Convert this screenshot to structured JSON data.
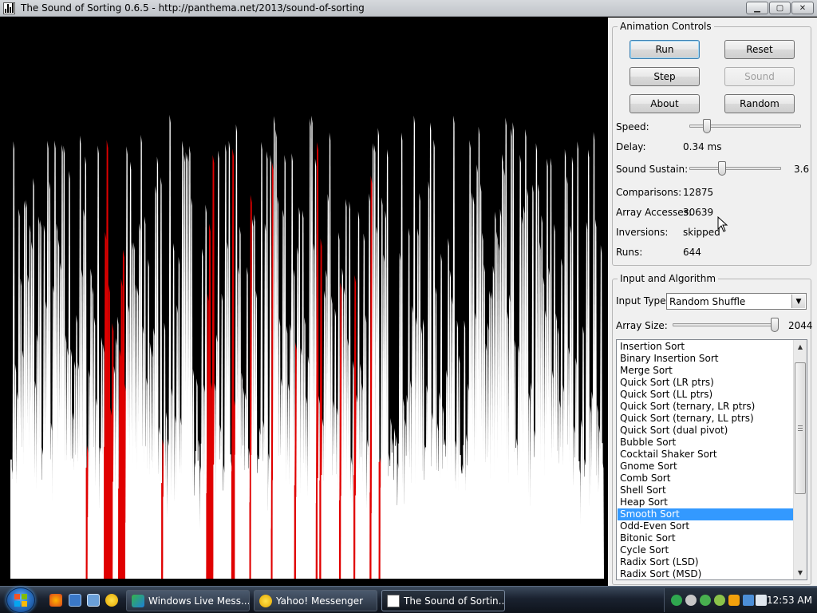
{
  "window": {
    "title": "The Sound of Sorting 0.6.5 - http://panthema.net/2013/sound-of-sorting",
    "minimize_label": "▁",
    "maximize_label": "▢",
    "close_label": "✕"
  },
  "animation_controls": {
    "legend": "Animation Controls",
    "buttons": {
      "run": "Run",
      "reset": "Reset",
      "step": "Step",
      "sound": "Sound",
      "about": "About",
      "random": "Random"
    },
    "speed_label": "Speed:",
    "speed_level": 0.16,
    "delay_label": "Delay:",
    "delay_value": "0.34 ms",
    "sustain_label": "Sound Sustain:",
    "sustain_level": 0.36,
    "sustain_value": "3.6",
    "comparisons_label": "Comparisons:",
    "comparisons_value": "12875",
    "accesses_label": "Array Accesses:",
    "accesses_value": "30639",
    "inversions_label": "Inversions:",
    "inversions_value": "skipped",
    "runs_label": "Runs:",
    "runs_value": "644"
  },
  "input_algorithm": {
    "legend": "Input and Algorithm",
    "input_type_label": "Input Type:",
    "input_type_value": "Random Shuffle",
    "array_size_label": "Array Size:",
    "array_size_level": 0.96,
    "array_size_value": "2044",
    "algorithms": [
      "Insertion Sort",
      "Binary Insertion Sort",
      "Merge Sort",
      "Quick Sort (LR ptrs)",
      "Quick Sort (LL ptrs)",
      "Quick Sort (ternary, LR ptrs)",
      "Quick Sort (ternary, LL ptrs)",
      "Quick Sort (dual pivot)",
      "Bubble Sort",
      "Cocktail Shaker Sort",
      "Gnome Sort",
      "Comb Sort",
      "Shell Sort",
      "Heap Sort",
      "Smooth Sort",
      "Odd-Even Sort",
      "Bitonic Sort",
      "Cycle Sort",
      "Radix Sort (LSD)",
      "Radix Sort (MSD)"
    ],
    "selected_index": 14
  },
  "colors": {
    "bar": "#ffffff",
    "highlight": "#e00000",
    "background": "#000000",
    "selection": "#3399ff"
  },
  "taskbar": {
    "items": [
      {
        "label": "Windows Live Mess...",
        "icon": "messenger-people-icon",
        "active": false
      },
      {
        "label": "Yahoo! Messenger",
        "icon": "yahoo-smiley-icon",
        "active": false
      },
      {
        "label": "The Sound of Sortin...",
        "icon": "sound-of-sorting-icon",
        "active": true
      }
    ],
    "clock": "12:53 AM"
  }
}
